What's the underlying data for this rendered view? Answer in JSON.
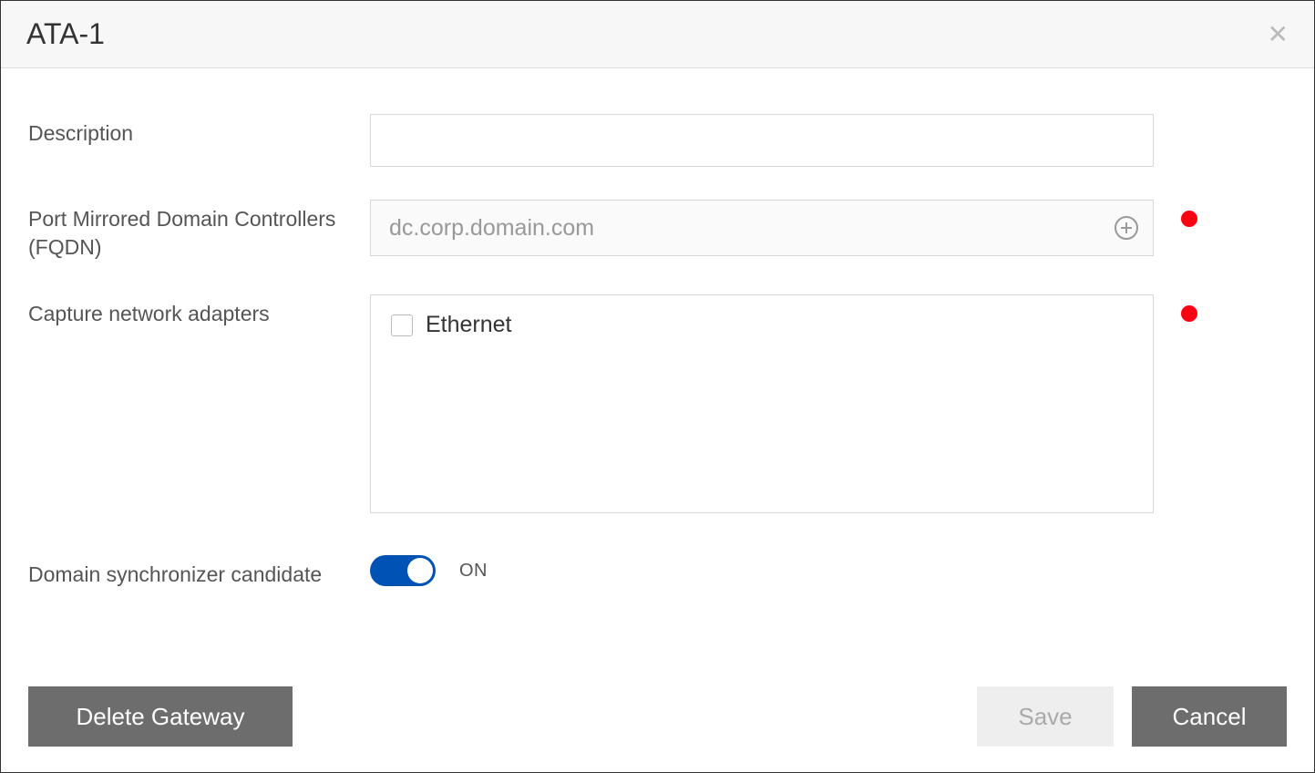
{
  "dialog": {
    "title": "ATA-1"
  },
  "form": {
    "description": {
      "label": "Description",
      "value": ""
    },
    "fqdn": {
      "label": "Port Mirrored Domain Controllers (FQDN)",
      "placeholder": "dc.corp.domain.com",
      "value": "",
      "status": "required"
    },
    "adapters": {
      "label": "Capture network adapters",
      "items": [
        {
          "name": "Ethernet",
          "checked": false
        }
      ],
      "status": "required"
    },
    "sync": {
      "label": "Domain synchronizer candidate",
      "on": true,
      "state_text": "ON"
    }
  },
  "footer": {
    "delete": "Delete Gateway",
    "save": "Save",
    "cancel": "Cancel"
  },
  "colors": {
    "accent": "#0052b5",
    "error": "#ff0013",
    "button_gray": "#6d6d6d"
  }
}
